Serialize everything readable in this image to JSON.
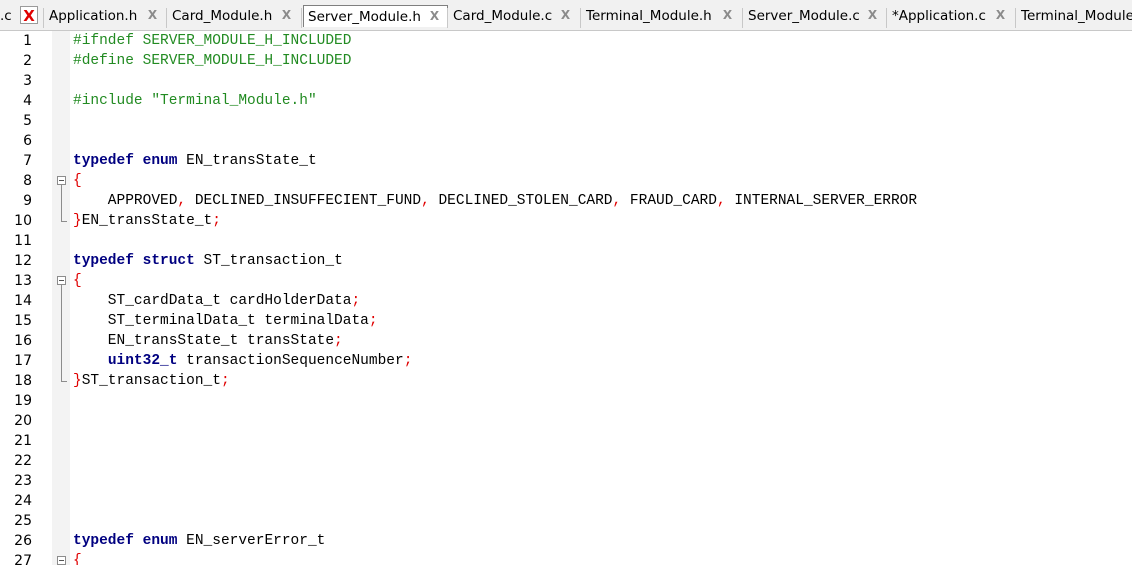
{
  "tabs": [
    {
      "label": ".c",
      "close": "close-icon-red",
      "active": false
    },
    {
      "label": "Application.h",
      "close": "close-icon",
      "active": false
    },
    {
      "label": "Card_Module.h",
      "close": "close-icon",
      "active": false
    },
    {
      "label": "Server_Module.h",
      "close": "close-icon",
      "active": true
    },
    {
      "label": "Card_Module.c",
      "close": "close-icon",
      "active": false
    },
    {
      "label": "Terminal_Module.h",
      "close": "close-icon",
      "active": false
    },
    {
      "label": "Server_Module.c",
      "close": "close-icon",
      "active": false
    },
    {
      "label": "*Application.c",
      "close": "close-icon",
      "active": false
    },
    {
      "label": "Terminal_Module",
      "close": "",
      "active": false
    }
  ],
  "close_glyph": "X",
  "colors": {
    "keyword": "#000080",
    "preprocessor": "#228b22",
    "operator": "#e00000",
    "close_red": "#e00000"
  },
  "lines": [
    {
      "n": "1",
      "tokens": [
        [
          "pp",
          "#ifndef SERVER_MODULE_H_INCLUDED"
        ]
      ]
    },
    {
      "n": "2",
      "tokens": [
        [
          "pp",
          "#define SERVER_MODULE_H_INCLUDED"
        ]
      ]
    },
    {
      "n": "3",
      "tokens": []
    },
    {
      "n": "4",
      "tokens": [
        [
          "pp",
          "#include \"Terminal_Module.h\""
        ]
      ]
    },
    {
      "n": "5",
      "tokens": []
    },
    {
      "n": "6",
      "tokens": []
    },
    {
      "n": "7",
      "tokens": [
        [
          "kw",
          "typedef"
        ],
        [
          "id",
          " "
        ],
        [
          "kw",
          "enum"
        ],
        [
          "id",
          " EN_transState_t"
        ]
      ]
    },
    {
      "n": "8",
      "fold": "start",
      "tokens": [
        [
          "op",
          "{"
        ]
      ]
    },
    {
      "n": "9",
      "tokens": [
        [
          "id",
          "    APPROVED"
        ],
        [
          "op",
          ","
        ],
        [
          "id",
          " DECLINED_INSUFFECIENT_FUND"
        ],
        [
          "op",
          ","
        ],
        [
          "id",
          " DECLINED_STOLEN_CARD"
        ],
        [
          "op",
          ","
        ],
        [
          "id",
          " FRAUD_CARD"
        ],
        [
          "op",
          ","
        ],
        [
          "id",
          " INTERNAL_SERVER_ERROR"
        ]
      ]
    },
    {
      "n": "10",
      "fold": "end",
      "tokens": [
        [
          "op",
          "}"
        ],
        [
          "id",
          "EN_transState_t"
        ],
        [
          "op",
          ";"
        ]
      ]
    },
    {
      "n": "11",
      "tokens": []
    },
    {
      "n": "12",
      "tokens": [
        [
          "kw",
          "typedef"
        ],
        [
          "id",
          " "
        ],
        [
          "kw",
          "struct"
        ],
        [
          "id",
          " ST_transaction_t"
        ]
      ]
    },
    {
      "n": "13",
      "fold": "start",
      "tokens": [
        [
          "op",
          "{"
        ]
      ]
    },
    {
      "n": "14",
      "tokens": [
        [
          "id",
          "    ST_cardData_t cardHolderData"
        ],
        [
          "op",
          ";"
        ]
      ]
    },
    {
      "n": "15",
      "tokens": [
        [
          "id",
          "    ST_terminalData_t terminalData"
        ],
        [
          "op",
          ";"
        ]
      ]
    },
    {
      "n": "16",
      "tokens": [
        [
          "id",
          "    EN_transState_t transState"
        ],
        [
          "op",
          ";"
        ]
      ]
    },
    {
      "n": "17",
      "tokens": [
        [
          "id",
          "    "
        ],
        [
          "kw",
          "uint32_t"
        ],
        [
          "id",
          " transactionSequenceNumber"
        ],
        [
          "op",
          ";"
        ]
      ]
    },
    {
      "n": "18",
      "fold": "end",
      "tokens": [
        [
          "op",
          "}"
        ],
        [
          "id",
          "ST_transaction_t"
        ],
        [
          "op",
          ";"
        ]
      ]
    },
    {
      "n": "19",
      "tokens": []
    },
    {
      "n": "20",
      "tokens": []
    },
    {
      "n": "21",
      "tokens": []
    },
    {
      "n": "22",
      "tokens": []
    },
    {
      "n": "23",
      "tokens": []
    },
    {
      "n": "24",
      "tokens": []
    },
    {
      "n": "25",
      "tokens": []
    },
    {
      "n": "26",
      "tokens": [
        [
          "kw",
          "typedef"
        ],
        [
          "id",
          " "
        ],
        [
          "kw",
          "enum"
        ],
        [
          "id",
          " EN_serverError_t"
        ]
      ]
    },
    {
      "n": "27",
      "fold": "start",
      "tokens": [
        [
          "op",
          "{"
        ]
      ]
    }
  ]
}
